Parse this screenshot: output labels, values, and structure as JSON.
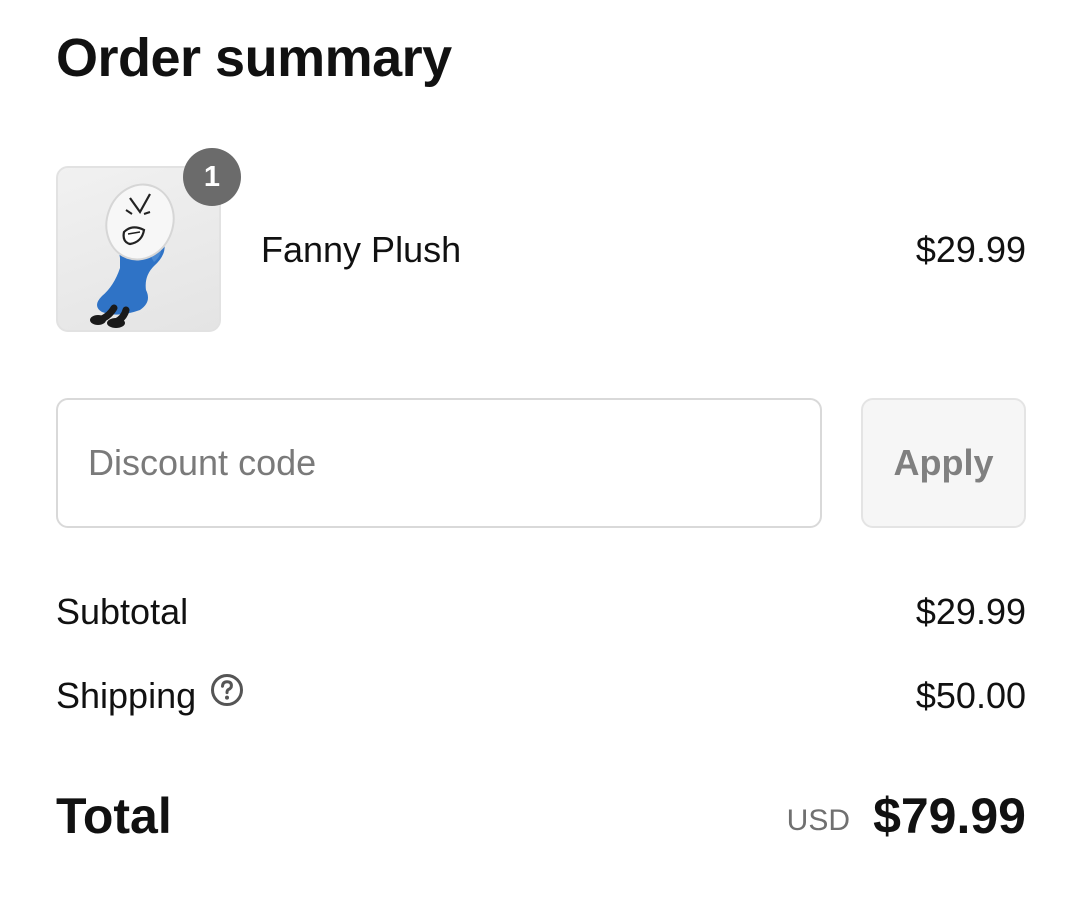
{
  "order_summary": {
    "title": "Order summary",
    "items": [
      {
        "name": "Fanny Plush",
        "price": "$29.99",
        "quantity": "1",
        "image_icon": "plush-toy-image"
      }
    ],
    "discount": {
      "placeholder": "Discount code",
      "value": "",
      "apply_label": "Apply"
    },
    "subtotal": {
      "label": "Subtotal",
      "value": "$29.99"
    },
    "shipping": {
      "label": "Shipping",
      "value": "$50.00",
      "help_icon": "question-circle-icon"
    },
    "total": {
      "label": "Total",
      "currency": "USD",
      "value": "$79.99"
    }
  },
  "colors": {
    "text": "#111111",
    "muted": "#707070",
    "badge": "#6b6b6b",
    "border": "#d9d9d9",
    "button_bg": "#f6f6f6",
    "plush_blue": "#2f73c6"
  }
}
